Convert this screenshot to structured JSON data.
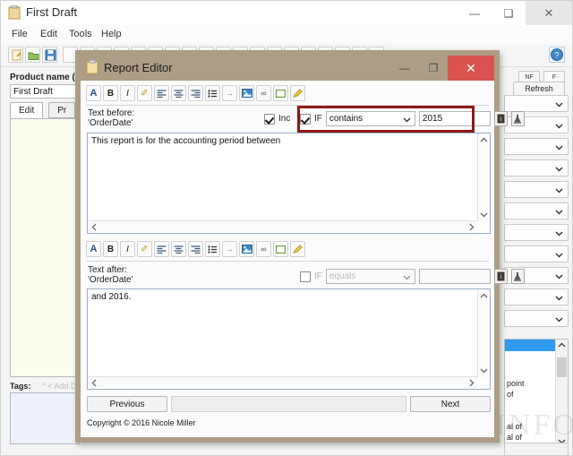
{
  "main_window": {
    "title": "First Draft",
    "title_icon": "clipboard-icon",
    "window_controls": {
      "minimize": "—",
      "maximize": "❑",
      "close": "✕"
    },
    "menu": [
      "File",
      "Edit",
      "Tools",
      "Help"
    ],
    "toolbar": {
      "help_icon": "help-circle-icon",
      "buttons": [
        "new-document-icon",
        "open-folder-icon",
        "save-icon",
        "cut-icon",
        "copy-icon",
        "paste-icon",
        "undo-icon",
        "redo-icon",
        "print-icon",
        "preview-icon",
        "find-icon",
        "replace-icon",
        "insert-field-icon",
        "insert-table-icon",
        "insert-image-icon",
        "bold-icon",
        "italic-icon",
        "underline-icon",
        "color-icon",
        "delete-icon",
        "settings-icon",
        "grid-icon"
      ]
    },
    "product_label": "Product name (",
    "product_value": "First Draft",
    "tabs": [
      {
        "label": "Edit",
        "selected": true
      },
      {
        "label": "Pr",
        "selected": false
      }
    ],
    "refresh_button": "Refresh",
    "nf_button": "NF",
    "f_button": "F",
    "tags_label": "Tags:",
    "tags_placeholder": "° < Add D",
    "right_list": {
      "rows": [
        "point",
        "of",
        "al of",
        "al of"
      ]
    },
    "dropdown_count": 11
  },
  "dialog": {
    "title": "Report Editor",
    "title_icon": "clipboard-icon",
    "window_controls": {
      "minimize": "—",
      "maximize": "❐",
      "close": "✕"
    },
    "rich_toolbar": [
      {
        "name": "font-icon",
        "glyph": "A"
      },
      {
        "name": "bold-icon",
        "glyph": "B"
      },
      {
        "name": "italic-icon",
        "glyph": "I"
      },
      {
        "name": "format-painter-icon",
        "glyph": "✐"
      },
      {
        "name": "align-left-icon",
        "glyph": "≡"
      },
      {
        "name": "align-center-icon",
        "glyph": "≡"
      },
      {
        "name": "align-right-icon",
        "glyph": "≡"
      },
      {
        "name": "bullet-list-icon",
        "glyph": "☰"
      },
      {
        "name": "indent-icon",
        "glyph": "→"
      },
      {
        "name": "insert-image-icon",
        "glyph": "▣"
      },
      {
        "name": "insert-link-icon",
        "glyph": "∞"
      },
      {
        "name": "text-box-icon",
        "glyph": "□"
      },
      {
        "name": "highlighter-icon",
        "glyph": "✒"
      }
    ],
    "section_before": {
      "label_line1": "Text before:",
      "label_line2": "'OrderDate'",
      "include_checkbox": {
        "label": "Inc",
        "checked": true
      },
      "if_checkbox": {
        "label": "IF",
        "checked": true
      },
      "operator": "contains",
      "value": "2015",
      "icon_buttons": [
        "info-field-icon",
        "insert-marker-icon"
      ],
      "text": "This report is for the accounting period between"
    },
    "section_after": {
      "label_line1": "Text after:",
      "label_line2": "'OrderDate'",
      "if_checkbox": {
        "label": "IF",
        "checked": false
      },
      "operator": "equals",
      "value": "",
      "icon_buttons": [
        "info-field-icon",
        "insert-marker-icon"
      ],
      "text": "and 2016."
    },
    "previous_button": "Previous",
    "next_button": "Next",
    "copyright": "Copyright © 2016 Nicole Miller",
    "highlight_color": "#8c1a1a",
    "titlebar_color": "#ad9d87",
    "close_color": "#d9534f"
  },
  "watermark": {
    "text": "SIEUSACH.INFO"
  }
}
